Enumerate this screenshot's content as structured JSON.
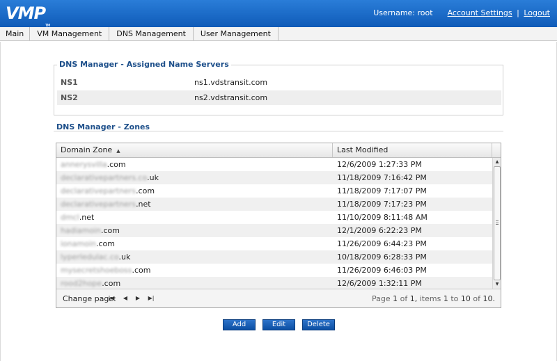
{
  "app": {
    "logo_text": "VMP",
    "logo_tm": "TM",
    "username_label": "Username: root",
    "account_settings_link": "Account Settings",
    "separator": "|",
    "logout_link": "Logout"
  },
  "nav": {
    "items": [
      {
        "label": "Main"
      },
      {
        "label": "VM Management"
      },
      {
        "label": "DNS Management"
      },
      {
        "label": "User Management"
      }
    ]
  },
  "name_servers": {
    "title": "DNS Manager - Assigned Name Servers",
    "rows": [
      {
        "key": "NS1",
        "value": "ns1.vdstransit.com"
      },
      {
        "key": "NS2",
        "value": "ns2.vdstransit.com"
      }
    ]
  },
  "zones": {
    "title": "DNS Manager - Zones",
    "columns": {
      "domain_zone": "Domain Zone",
      "last_modified": "Last Modified",
      "sort_indicator": "▲"
    },
    "rows": [
      {
        "domain_blurred": "annerysvilla",
        "domain_suffix": ".com",
        "last_modified": "12/6/2009 1:27:33 PM"
      },
      {
        "domain_blurred": "declarativepartners.co",
        "domain_suffix": ".uk",
        "last_modified": "11/18/2009 7:16:42 PM"
      },
      {
        "domain_blurred": "declarativepartners",
        "domain_suffix": ".com",
        "last_modified": "11/18/2009 7:17:07 PM"
      },
      {
        "domain_blurred": "declarativepartners",
        "domain_suffix": ".net",
        "last_modified": "11/18/2009 7:17:23 PM"
      },
      {
        "domain_blurred": "dmcl",
        "domain_suffix": ".net",
        "last_modified": "11/10/2009 8:11:48 AM"
      },
      {
        "domain_blurred": "hadiamoin",
        "domain_suffix": ".com",
        "last_modified": "12/1/2009 6:22:23 PM"
      },
      {
        "domain_blurred": "ionamoin",
        "domain_suffix": ".com",
        "last_modified": "11/26/2009 6:44:23 PM"
      },
      {
        "domain_blurred": "lyperledulac.co",
        "domain_suffix": ".uk",
        "last_modified": "10/18/2009 6:28:33 PM"
      },
      {
        "domain_blurred": "mysecretshoeboss",
        "domain_suffix": ".com",
        "last_modified": "11/26/2009 6:46:03 PM"
      },
      {
        "domain_blurred": "rood2hope",
        "domain_suffix": ".com",
        "last_modified": "12/6/2009 1:32:11 PM"
      }
    ],
    "pager": {
      "label": "Change page:",
      "first_icon": "first-page-icon",
      "prev_icon": "prev-page-icon",
      "next_icon": "next-page-icon",
      "last_icon": "last-page-icon",
      "page_word": "Page",
      "page_current": "1",
      "of_word": "of",
      "page_total": "1,",
      "items_word": "items",
      "items_from": "1",
      "to_word": "to",
      "items_to": "10",
      "items_total": "10."
    }
  },
  "actions": {
    "add": "Add",
    "edit": "Edit",
    "delete": "Delete"
  },
  "colors": {
    "header": "#1a6bc9",
    "section_title": "#1d4f8a",
    "button": "#1b5fb5"
  }
}
